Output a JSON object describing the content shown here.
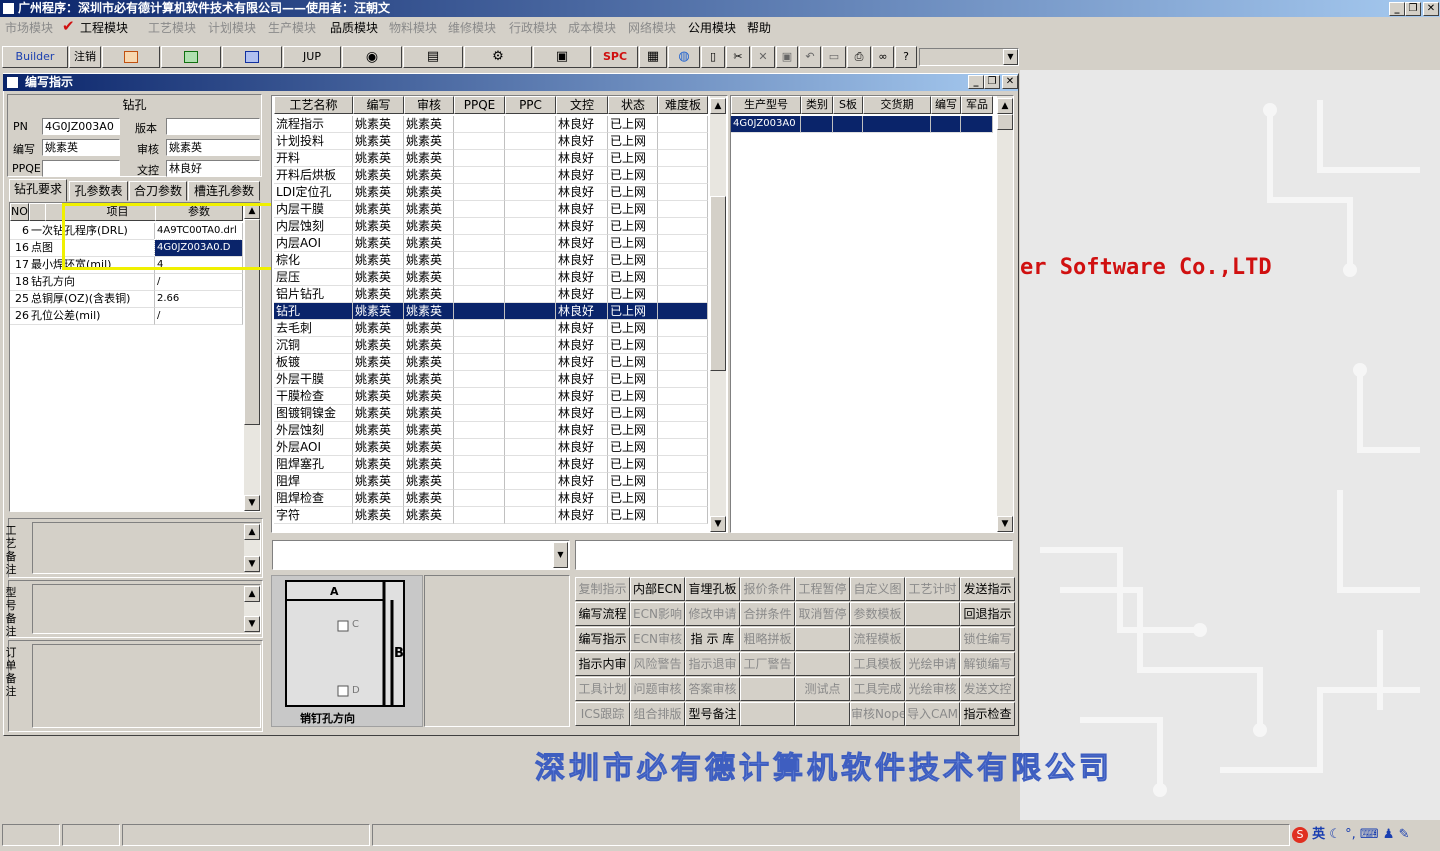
{
  "app_title": "广州程序：深圳市必有德计算机软件技术有限公司——使用者：汪朝文",
  "window_controls": {
    "minimize": "_",
    "restore": "❐",
    "close": "✕"
  },
  "menu": [
    {
      "label": "市场模块",
      "enabled": false
    },
    {
      "label": "工程模块",
      "enabled": true
    },
    {
      "label": "工艺模块",
      "enabled": false
    },
    {
      "label": "计划模块",
      "enabled": false
    },
    {
      "label": "生产模块",
      "enabled": false
    },
    {
      "label": "品质模块",
      "enabled": true
    },
    {
      "label": "物料模块",
      "enabled": false
    },
    {
      "label": "维修模块",
      "enabled": false
    },
    {
      "label": "行政模块",
      "enabled": false
    },
    {
      "label": "成本模块",
      "enabled": false
    },
    {
      "label": "网络模块",
      "enabled": false
    },
    {
      "label": "公用模块",
      "enabled": true
    },
    {
      "label": "帮助",
      "enabled": true
    }
  ],
  "menu_check": "✔",
  "toolbar": {
    "builder": "Builder",
    "logout": "注销",
    "jup": "JUP",
    "spc": "SPC",
    "combo_value": ""
  },
  "toolbar_icons": [
    "ppt-icon",
    "excel-icon",
    "word-icon",
    "eye-icon",
    "database-icon",
    "network-icon",
    "printer-icon",
    "calculator-icon",
    "globe-icon",
    "new-doc-icon",
    "cut-icon",
    "delete-icon",
    "save-icon",
    "undo-icon",
    "preview-icon",
    "print-icon",
    "binoculars-icon",
    "help-icon"
  ],
  "desktop": {
    "brand_text": "er Software Co.,LTD",
    "company_text": "深圳市必有德计算机软件技术有限公司"
  },
  "child": {
    "title": "编写指示",
    "left": {
      "section_title": "钻孔",
      "fields": [
        {
          "label": "PN",
          "value": "4G0JZ003A0"
        },
        {
          "label": "版本",
          "value": ""
        },
        {
          "label": "编写",
          "value": "姚素英"
        },
        {
          "label": "审核",
          "value": "姚素英"
        },
        {
          "label": "PPQE",
          "value": ""
        },
        {
          "label": "文控",
          "value": "林良好"
        }
      ],
      "tabs": [
        "钻孔要求",
        "孔参数表",
        "合刀参数",
        "槽连孔参数"
      ],
      "param_headers": [
        "NO",
        "",
        "项目",
        "参数"
      ],
      "param_rows": [
        {
          "no": "6",
          "item": "一次钻孔程序(DRL)",
          "value": "4A9TC00TA0.drl",
          "selected": false
        },
        {
          "no": "16",
          "item": "点图",
          "value": "4G0JZ003A0.D",
          "selected": true
        },
        {
          "no": "17",
          "item": "最小焊环宽(mil)",
          "value": "4",
          "selected": false
        },
        {
          "no": "18",
          "item": "钻孔方向",
          "value": "/",
          "selected": false
        },
        {
          "no": "25",
          "item": "总铜厚(OZ)(含表铜)",
          "value": "2.66",
          "selected": false
        },
        {
          "no": "26",
          "item": "孔位公差(mil)",
          "value": "/",
          "selected": false
        }
      ],
      "remarks": [
        "工艺备注",
        "型号备注",
        "订单备注"
      ]
    },
    "process": {
      "headers": [
        "工艺名称",
        "编写",
        "审核",
        "PPQE",
        "PPC",
        "文控",
        "状态",
        "难度板"
      ],
      "rows": [
        [
          "流程指示",
          "姚素英",
          "姚素英",
          "",
          "",
          "林良好",
          "已上网",
          ""
        ],
        [
          "计划投料",
          "姚素英",
          "姚素英",
          "",
          "",
          "林良好",
          "已上网",
          ""
        ],
        [
          "开料",
          "姚素英",
          "姚素英",
          "",
          "",
          "林良好",
          "已上网",
          ""
        ],
        [
          "开料后烘板",
          "姚素英",
          "姚素英",
          "",
          "",
          "林良好",
          "已上网",
          ""
        ],
        [
          "LDI定位孔",
          "姚素英",
          "姚素英",
          "",
          "",
          "林良好",
          "已上网",
          ""
        ],
        [
          "内层干膜",
          "姚素英",
          "姚素英",
          "",
          "",
          "林良好",
          "已上网",
          ""
        ],
        [
          "内层蚀刻",
          "姚素英",
          "姚素英",
          "",
          "",
          "林良好",
          "已上网",
          ""
        ],
        [
          "内层AOI",
          "姚素英",
          "姚素英",
          "",
          "",
          "林良好",
          "已上网",
          ""
        ],
        [
          "棕化",
          "姚素英",
          "姚素英",
          "",
          "",
          "林良好",
          "已上网",
          ""
        ],
        [
          "层压",
          "姚素英",
          "姚素英",
          "",
          "",
          "林良好",
          "已上网",
          ""
        ],
        [
          "铝片钻孔",
          "姚素英",
          "姚素英",
          "",
          "",
          "林良好",
          "已上网",
          ""
        ],
        [
          "钻孔",
          "姚素英",
          "姚素英",
          "",
          "",
          "林良好",
          "已上网",
          ""
        ],
        [
          "去毛刺",
          "姚素英",
          "姚素英",
          "",
          "",
          "林良好",
          "已上网",
          ""
        ],
        [
          "沉铜",
          "姚素英",
          "姚素英",
          "",
          "",
          "林良好",
          "已上网",
          ""
        ],
        [
          "板镀",
          "姚素英",
          "姚素英",
          "",
          "",
          "林良好",
          "已上网",
          ""
        ],
        [
          "外层干膜",
          "姚素英",
          "姚素英",
          "",
          "",
          "林良好",
          "已上网",
          ""
        ],
        [
          "干膜检查",
          "姚素英",
          "姚素英",
          "",
          "",
          "林良好",
          "已上网",
          ""
        ],
        [
          "图镀铜镍金",
          "姚素英",
          "姚素英",
          "",
          "",
          "林良好",
          "已上网",
          ""
        ],
        [
          "外层蚀刻",
          "姚素英",
          "姚素英",
          "",
          "",
          "林良好",
          "已上网",
          ""
        ],
        [
          "外层AOI",
          "姚素英",
          "姚素英",
          "",
          "",
          "林良好",
          "已上网",
          ""
        ],
        [
          "阻焊塞孔",
          "姚素英",
          "姚素英",
          "",
          "",
          "林良好",
          "已上网",
          ""
        ],
        [
          "阻焊",
          "姚素英",
          "姚素英",
          "",
          "",
          "林良好",
          "已上网",
          ""
        ],
        [
          "阻焊检查",
          "姚素英",
          "姚素英",
          "",
          "",
          "林良好",
          "已上网",
          ""
        ],
        [
          "字符",
          "姚素英",
          "姚素英",
          "",
          "",
          "林良好",
          "已上网",
          ""
        ]
      ],
      "selected_row": 11
    },
    "models": {
      "headers": [
        "生产型号",
        "类别",
        "S板",
        "交货期",
        "编写",
        "军品"
      ],
      "rows": [
        [
          "4G0JZ003A0",
          "",
          "",
          "",
          "",
          ""
        ]
      ]
    },
    "diagram": {
      "label_a": "A",
      "label_b": "B",
      "label_c": "C",
      "label_d": "D",
      "caption": "销钉孔方向"
    },
    "actions": [
      [
        {
          "label": "复制指示",
          "enabled": false
        },
        {
          "label": "内部ECN",
          "enabled": true
        },
        {
          "label": "盲埋孔板",
          "enabled": true
        },
        {
          "label": "报价条件",
          "enabled": false
        },
        {
          "label": "工程暂停",
          "enabled": false
        },
        {
          "label": "自定义图",
          "enabled": false
        },
        {
          "label": "工艺计时",
          "enabled": false
        },
        {
          "label": "发送指示",
          "enabled": true
        }
      ],
      [
        {
          "label": "编写流程",
          "enabled": true
        },
        {
          "label": "ECN影响",
          "enabled": false
        },
        {
          "label": "修改申请",
          "enabled": false
        },
        {
          "label": "合拼条件",
          "enabled": false
        },
        {
          "label": "取消暂停",
          "enabled": false
        },
        {
          "label": "参数模板",
          "enabled": false
        },
        {
          "label": "",
          "enabled": false
        },
        {
          "label": "回退指示",
          "enabled": true
        }
      ],
      [
        {
          "label": "编写指示",
          "enabled": true
        },
        {
          "label": "ECN审核",
          "enabled": false
        },
        {
          "label": "指 示 库",
          "enabled": true
        },
        {
          "label": "粗略拼板",
          "enabled": false
        },
        {
          "label": "",
          "enabled": false
        },
        {
          "label": "流程模板",
          "enabled": false
        },
        {
          "label": "",
          "enabled": false
        },
        {
          "label": "锁住编写",
          "enabled": false
        }
      ],
      [
        {
          "label": "指示内审",
          "enabled": true
        },
        {
          "label": "风险警告",
          "enabled": false
        },
        {
          "label": "指示退审",
          "enabled": false
        },
        {
          "label": "工厂警告",
          "enabled": false
        },
        {
          "label": "",
          "enabled": false
        },
        {
          "label": "工具模板",
          "enabled": false
        },
        {
          "label": "光绘申请",
          "enabled": false
        },
        {
          "label": "解锁编写",
          "enabled": false
        }
      ],
      [
        {
          "label": "工具计划",
          "enabled": false
        },
        {
          "label": "问题审核",
          "enabled": false
        },
        {
          "label": "答案审核",
          "enabled": false
        },
        {
          "label": "",
          "enabled": false
        },
        {
          "label": "测试点",
          "enabled": false
        },
        {
          "label": "工具完成",
          "enabled": false
        },
        {
          "label": "光绘审核",
          "enabled": false
        },
        {
          "label": "发送文控",
          "enabled": false
        }
      ],
      [
        {
          "label": "ICS跟踪",
          "enabled": false
        },
        {
          "label": "组合排版",
          "enabled": false
        },
        {
          "label": "型号备注",
          "enabled": true
        },
        {
          "label": "",
          "enabled": false
        },
        {
          "label": "",
          "enabled": false
        },
        {
          "label": "审核Nope",
          "enabled": false
        },
        {
          "label": "导入CAM",
          "enabled": false
        },
        {
          "label": "指示检查",
          "enabled": true
        }
      ]
    ]
  },
  "tray": {
    "lang": "英",
    "items": [
      "sogou-icon",
      "moon-icon",
      "punctuation-icon",
      "keyboard-icon",
      "user-icon",
      "tools-icon"
    ]
  },
  "colors": {
    "title_active": "#0a246a",
    "selection": "#0a246a",
    "highlight_box": "#f0f000",
    "brand_red": "#d01010"
  }
}
